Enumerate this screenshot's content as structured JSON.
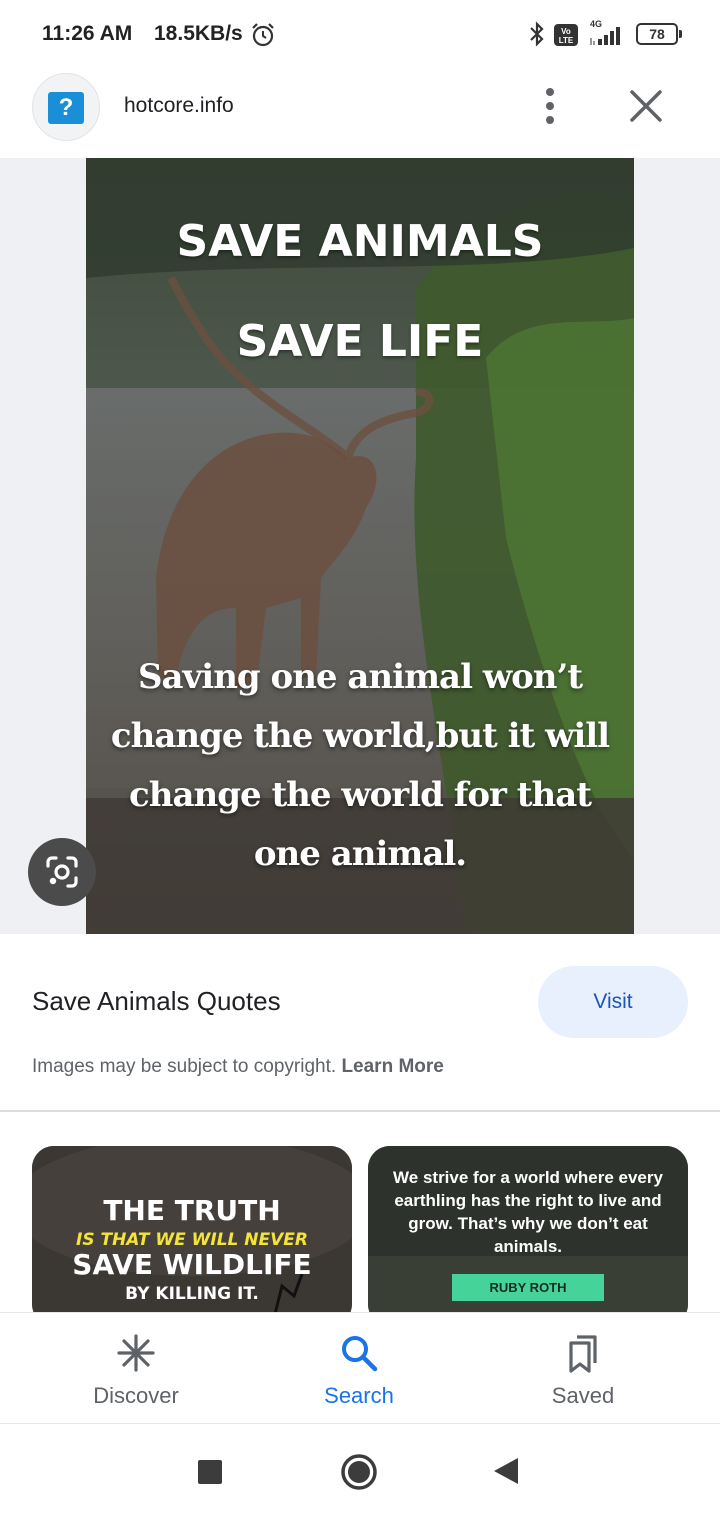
{
  "status_bar": {
    "time": "11:26 AM",
    "speed": "18.5KB/s",
    "volte": "Vo LTE",
    "network_type": "4G",
    "battery": "78",
    "icons": [
      "alarm-icon",
      "bluetooth-icon",
      "signal-icon",
      "battery-icon"
    ]
  },
  "header": {
    "favicon_glyph": "?",
    "domain": "hotcore.info",
    "icons": [
      "more-vert-icon",
      "close-icon"
    ]
  },
  "poster": {
    "heading_line1": "SAVE ANIMALS",
    "heading_line2": "SAVE LIFE",
    "quote": "Saving one animal won’t change the world,but it will change the world for that one animal."
  },
  "result": {
    "title": "Save Animals Quotes",
    "visit_label": "Visit",
    "copyright_text": "Images may be subject to copyright.",
    "learn_more": "Learn More"
  },
  "related": [
    {
      "line1": "THE TRUTH",
      "line2": "IS THAT WE WILL NEVER",
      "line3": "SAVE WILDLIFE",
      "line4": "BY KILLING IT."
    },
    {
      "text": "We strive for a world where every earthling has the right to live and grow. That’s why we don’t eat animals.",
      "author": "RUBY ROTH"
    }
  ],
  "bottom_nav": {
    "items": [
      {
        "label": "Discover",
        "icon": "discover-icon"
      },
      {
        "label": "Search",
        "icon": "search-icon",
        "active": true
      },
      {
        "label": "Saved",
        "icon": "bookmarks-icon"
      }
    ],
    "active_color": "#1a73e8"
  },
  "colors": {
    "accent": "#1a73e8",
    "visit_bg": "#e8f0fe",
    "favicon_bg": "#1a8fd8"
  }
}
